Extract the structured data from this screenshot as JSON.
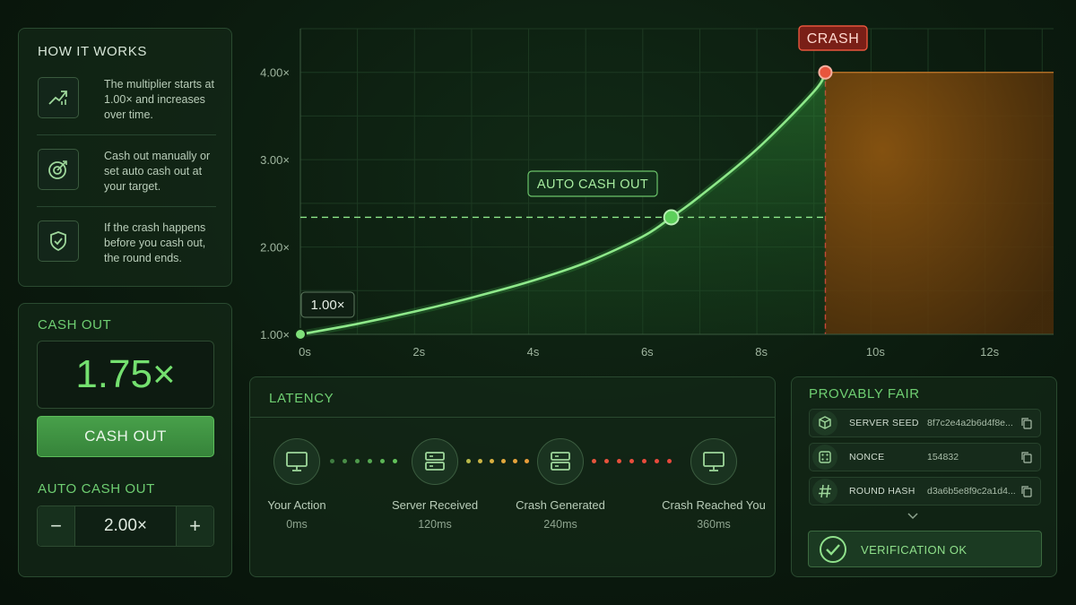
{
  "how_it_works": {
    "title": "HOW IT WORKS",
    "steps": [
      {
        "icon": "trend-up-icon",
        "text": "The multiplier starts at 1.00× and increases over time."
      },
      {
        "icon": "target-icon",
        "text": "Cash out manually or set auto cash out at your target."
      },
      {
        "icon": "shield-check-icon",
        "text": "If the crash happens before you cash out, the round ends."
      }
    ]
  },
  "cash_out": {
    "label": "CASH OUT",
    "current_multiplier": "1.75×",
    "button_label": "CASH OUT",
    "auto_label": "AUTO CASH OUT",
    "auto_value": "2.00×",
    "minus": "−",
    "plus": "+"
  },
  "chart_data": {
    "type": "line",
    "x_ticks": [
      "0s",
      "2s",
      "4s",
      "6s",
      "8s",
      "10s",
      "12s"
    ],
    "y_ticks": [
      "1.00×",
      "2.00×",
      "3.00×",
      "4.00×"
    ],
    "xlim": [
      0,
      13.2
    ],
    "ylim": [
      1.0,
      4.5
    ],
    "series": [
      {
        "x": [
          0,
          1,
          2,
          3,
          4,
          5,
          6,
          6.5,
          7,
          8,
          9,
          9.2
        ],
        "y": [
          1.0,
          1.12,
          1.26,
          1.42,
          1.6,
          1.82,
          2.12,
          2.34,
          2.58,
          3.12,
          3.78,
          4.0
        ]
      }
    ],
    "start_label": "1.00×",
    "auto_cash_out": {
      "x": 6.5,
      "y": 2.34,
      "label": "AUTO CASH OUT"
    },
    "crash": {
      "x": 9.2,
      "y": 4.0,
      "label": "CRASH"
    },
    "grid": true,
    "colors": {
      "line": "#8ee88a",
      "crash": "#e0463c",
      "crash_zone": "#7a4a10"
    }
  },
  "latency": {
    "title": "LATENCY",
    "nodes": [
      {
        "icon": "monitor-icon",
        "label": "Your Action",
        "ms": "0ms"
      },
      {
        "icon": "server-icon",
        "label": "Server Received",
        "ms": "120ms"
      },
      {
        "icon": "server-icon",
        "label": "Crash Generated",
        "ms": "240ms"
      },
      {
        "icon": "monitor-icon",
        "label": "Crash Reached You",
        "ms": "360ms"
      }
    ]
  },
  "provably_fair": {
    "title": "PROVABLY FAIR",
    "rows": [
      {
        "icon": "cube-icon",
        "key": "SERVER SEED",
        "value": "8f7c2e4a2b6d4f8e..."
      },
      {
        "icon": "dice-icon",
        "key": "NONCE",
        "value": "154832"
      },
      {
        "icon": "hash-icon",
        "key": "ROUND HASH",
        "value": "d3a6b5e8f9c2a1d4..."
      }
    ],
    "verification": "VERIFICATION OK"
  }
}
